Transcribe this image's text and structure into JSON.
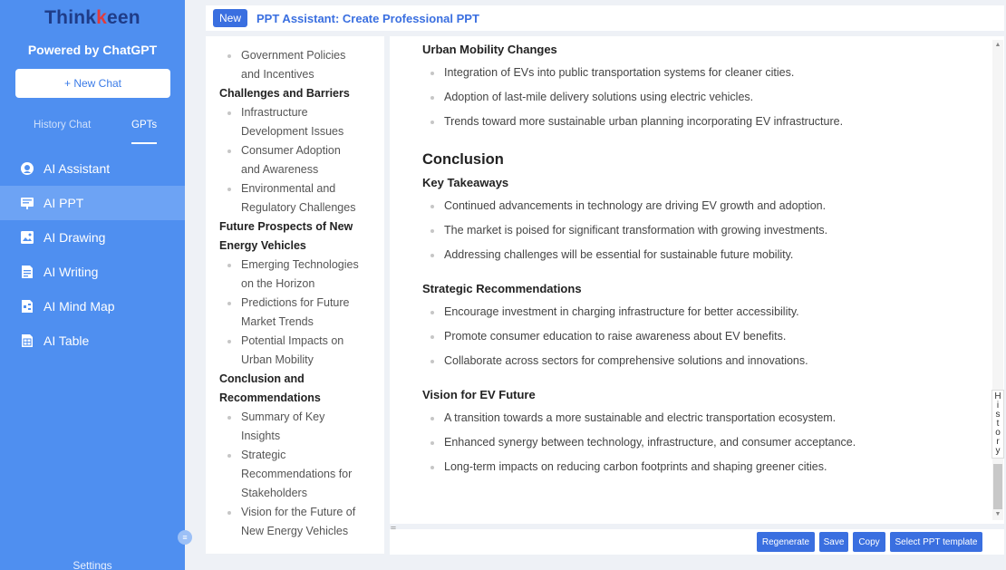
{
  "sidebar": {
    "logo_pre": "Think",
    "logo_k": "k",
    "logo_post": "een",
    "powered_by": "Powered by ChatGPT",
    "new_chat_label": "+ New Chat",
    "tabs": [
      {
        "label": "History Chat",
        "active": false
      },
      {
        "label": "GPTs",
        "active": true
      }
    ],
    "items": [
      {
        "label": "AI Assistant",
        "icon": "assistant-icon",
        "active": false
      },
      {
        "label": "AI PPT",
        "icon": "ppt-icon",
        "active": true
      },
      {
        "label": "AI Drawing",
        "icon": "drawing-icon",
        "active": false
      },
      {
        "label": "AI Writing",
        "icon": "writing-icon",
        "active": false
      },
      {
        "label": "AI Mind Map",
        "icon": "mindmap-icon",
        "active": false
      },
      {
        "label": "AI Table",
        "icon": "table-icon",
        "active": false
      }
    ],
    "settings_label": "Settings"
  },
  "header": {
    "badge": "New",
    "title": "PPT Assistant: Create Professional PPT"
  },
  "outline": {
    "lines": [
      {
        "type": "sub",
        "text": "Government Policies"
      },
      {
        "type": "cont",
        "text": "and Incentives"
      },
      {
        "type": "head",
        "text": "Challenges and Barriers"
      },
      {
        "type": "sub",
        "text": "Infrastructure"
      },
      {
        "type": "cont",
        "text": "Development Issues"
      },
      {
        "type": "sub",
        "text": "Consumer Adoption"
      },
      {
        "type": "cont",
        "text": "and Awareness"
      },
      {
        "type": "sub",
        "text": "Environmental and"
      },
      {
        "type": "cont",
        "text": "Regulatory Challenges"
      },
      {
        "type": "head",
        "text": "Future Prospects of New"
      },
      {
        "type": "head",
        "text": "Energy Vehicles"
      },
      {
        "type": "sub",
        "text": "Emerging Technologies"
      },
      {
        "type": "cont",
        "text": "on the Horizon"
      },
      {
        "type": "sub",
        "text": "Predictions for Future"
      },
      {
        "type": "cont",
        "text": "Market Trends"
      },
      {
        "type": "sub",
        "text": "Potential Impacts on"
      },
      {
        "type": "cont",
        "text": "Urban Mobility"
      },
      {
        "type": "head",
        "text": "Conclusion and"
      },
      {
        "type": "head",
        "text": "Recommendations"
      },
      {
        "type": "sub",
        "text": "Summary of Key"
      },
      {
        "type": "cont",
        "text": "Insights"
      },
      {
        "type": "sub",
        "text": "Strategic"
      },
      {
        "type": "cont",
        "text": "Recommendations for"
      },
      {
        "type": "cont",
        "text": "Stakeholders"
      },
      {
        "type": "sub",
        "text": "Vision for the Future of"
      },
      {
        "type": "cont",
        "text": "New Energy Vehicles"
      }
    ]
  },
  "content": {
    "blocks": [
      {
        "type": "h3",
        "text": "Urban Mobility Changes"
      },
      {
        "type": "li",
        "text": "Integration of EVs into public transportation systems for cleaner cities."
      },
      {
        "type": "li",
        "text": "Adoption of last-mile delivery solutions using electric vehicles."
      },
      {
        "type": "li",
        "text": "Trends toward more sustainable urban planning incorporating EV infrastructure."
      },
      {
        "type": "h2",
        "text": "Conclusion"
      },
      {
        "type": "h3",
        "text": "Key Takeaways"
      },
      {
        "type": "li",
        "text": "Continued advancements in technology are driving EV growth and adoption."
      },
      {
        "type": "li",
        "text": "The market is poised for significant transformation with growing investments."
      },
      {
        "type": "li",
        "text": "Addressing challenges will be essential for sustainable future mobility."
      },
      {
        "type": "h3",
        "text": "Strategic Recommendations"
      },
      {
        "type": "li",
        "text": "Encourage investment in charging infrastructure for better accessibility."
      },
      {
        "type": "li",
        "text": "Promote consumer education to raise awareness about EV benefits."
      },
      {
        "type": "li",
        "text": "Collaborate across sectors for comprehensive solutions and innovations."
      },
      {
        "type": "h3",
        "text": "Vision for EV Future"
      },
      {
        "type": "li",
        "text": "A transition towards a more sustainable and electric transportation ecosystem."
      },
      {
        "type": "li",
        "text": "Enhanced synergy between technology, infrastructure, and consumer acceptance."
      },
      {
        "type": "li",
        "text": "Long-term impacts on reducing carbon footprints and shaping greener cities."
      }
    ]
  },
  "history_tab": "History",
  "actions": {
    "regenerate": "Regenerate",
    "save": "Save",
    "copy": "Copy",
    "select_template": "Select PPT template"
  },
  "colors": {
    "sidebar_bg": "#4f8ff0",
    "accent": "#3a6fe0",
    "logo_dark": "#1f3c88",
    "logo_red": "#e23b3b"
  }
}
